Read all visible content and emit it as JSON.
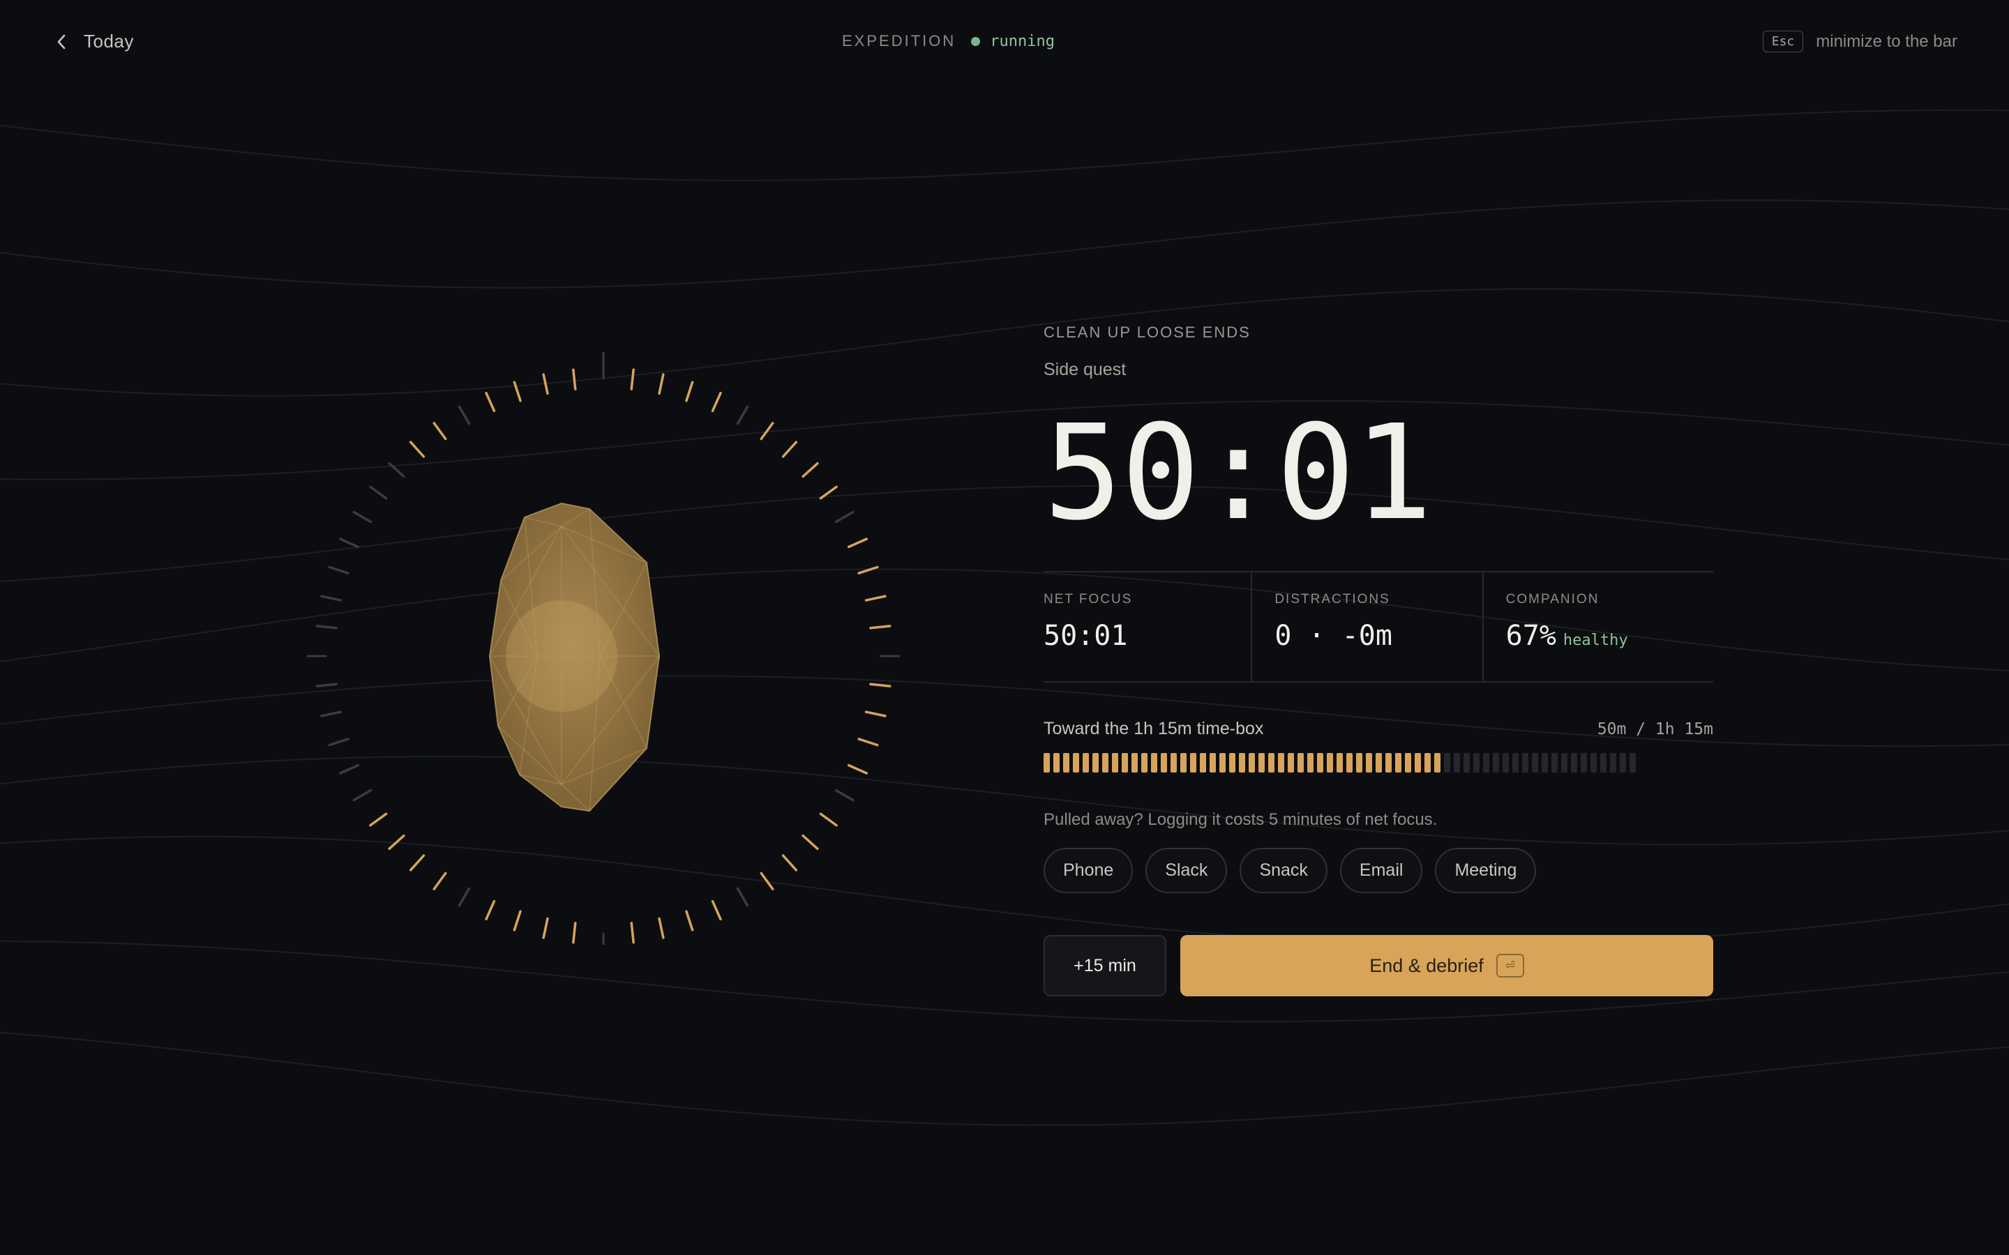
{
  "header": {
    "back_label": "Today",
    "status_label": "EXPEDITION",
    "status_value": "running",
    "esc_key": "Esc",
    "esc_hint": "minimize to the bar"
  },
  "quest": {
    "title": "CLEAN UP LOOSE ENDS",
    "type": "Side quest"
  },
  "timer": {
    "value": "50:01"
  },
  "stats": {
    "net_focus": {
      "label": "NET FOCUS",
      "value": "50:01"
    },
    "distractions": {
      "label": "DISTRACTIONS",
      "value": "0 · -0m"
    },
    "companion": {
      "label": "COMPANION",
      "value": "67%",
      "status": "healthy"
    }
  },
  "progress": {
    "label": "Toward the 1h 15m time-box",
    "count": "50m / 1h 15m",
    "fraction": 0.667
  },
  "distraction_prompt": "Pulled away? Logging it costs 5 minutes of net focus.",
  "chips": [
    "Phone",
    "Slack",
    "Snack",
    "Email",
    "Meeting"
  ],
  "actions": {
    "extend_label": "+15 min",
    "end_label": "End & debrief",
    "enter_key": "⏎"
  },
  "colors": {
    "accent": "#d7a45a",
    "status_green": "#8fc49a",
    "background": "#0c0d10"
  },
  "icons": {
    "back": "chevron-left-icon",
    "companion": "gem-icon"
  }
}
